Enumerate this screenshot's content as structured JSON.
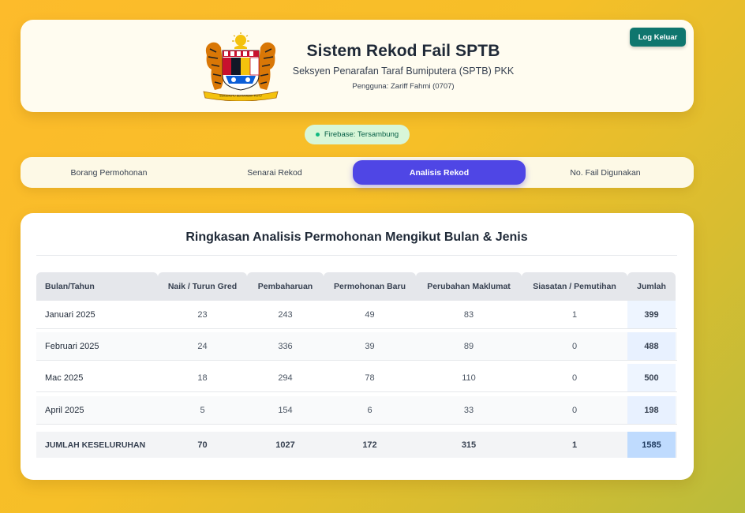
{
  "header": {
    "title": "Sistem Rekod Fail SPTB",
    "subtitle": "Seksyen Penarafan Taraf Bumiputera (SPTB) PKK",
    "user": "Pengguna: Zariff Fahmi (0707)",
    "logout_label": "Log Keluar",
    "crest_icon": "malaysia-coat-of-arms-icon",
    "crest_motto": "BERSEKUTU BERTAMBAH MUTU"
  },
  "status": {
    "label": "Firebase: Tersambung",
    "color": "#10b981"
  },
  "tabs": [
    {
      "label": "Borang Permohonan",
      "active": false
    },
    {
      "label": "Senarai Rekod",
      "active": false
    },
    {
      "label": "Analisis Rekod",
      "active": true
    },
    {
      "label": "No. Fail Digunakan",
      "active": false
    }
  ],
  "analysis": {
    "title": "Ringkasan Analisis Permohonan Mengikut Bulan & Jenis",
    "columns": [
      "Bulan/Tahun",
      "Naik / Turun Gred",
      "Pembaharuan",
      "Permohonan Baru",
      "Perubahan Maklumat",
      "Siasatan / Pemutihan",
      "Jumlah"
    ],
    "rows": [
      [
        "Januari 2025",
        "23",
        "243",
        "49",
        "83",
        "1",
        "399"
      ],
      [
        "Februari 2025",
        "24",
        "336",
        "39",
        "89",
        "0",
        "488"
      ],
      [
        "Mac 2025",
        "18",
        "294",
        "78",
        "110",
        "0",
        "500"
      ],
      [
        "April 2025",
        "5",
        "154",
        "6",
        "33",
        "0",
        "198"
      ]
    ],
    "total": [
      "JUMLAH KESELURUHAN",
      "70",
      "1027",
      "172",
      "315",
      "1",
      "1585"
    ]
  },
  "colors": {
    "accent": "#4f46e5",
    "logout": "#0f766e",
    "total_highlight": "#bfdbfe"
  }
}
